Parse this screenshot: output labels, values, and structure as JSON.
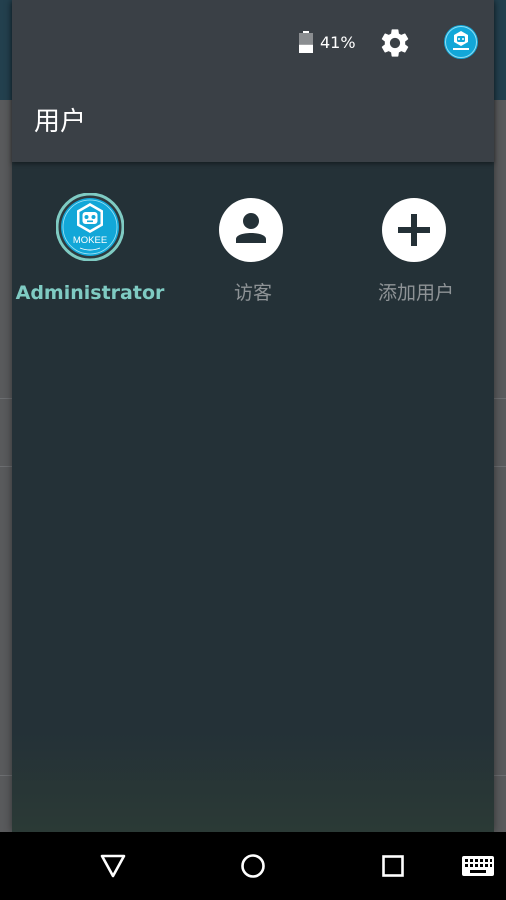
{
  "status": {
    "battery_text": "41%",
    "battery_level": 0.41
  },
  "panel": {
    "title": "用户"
  },
  "users": [
    {
      "label": "Administrator",
      "icon": "mokee-avatar-icon",
      "active": true
    },
    {
      "label": "访客",
      "icon": "guest-person-icon",
      "active": false
    },
    {
      "label": "添加用户",
      "icon": "add-icon",
      "active": false
    }
  ],
  "avatar": {
    "logo_text": "MOKEE"
  },
  "colors": {
    "panel_bg": "#243137",
    "header_bg": "#3a4046",
    "active_user": "#7fcbc3",
    "inactive_user": "#8e9396",
    "avatar_bg": "#12a7d8",
    "nav_bg": "#000000"
  },
  "nav": {
    "back_icon": "back-triangle-icon",
    "home_icon": "home-circle-icon",
    "recents_icon": "recents-square-icon",
    "keyboard_icon": "keyboard-icon"
  }
}
